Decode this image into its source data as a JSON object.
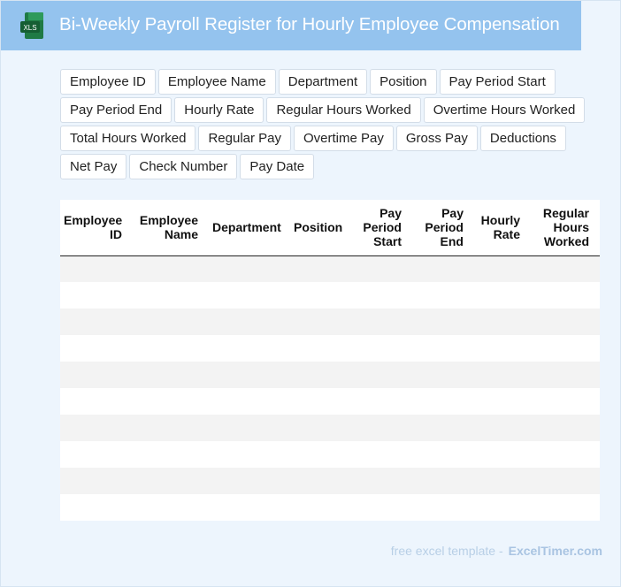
{
  "header": {
    "title": "Bi-Weekly Payroll Register for Hourly Employee Compensation",
    "icon": "xls-file-icon",
    "icon_label": "XLS",
    "background": "#94c3ee"
  },
  "fields": [
    "Employee ID",
    "Employee Name",
    "Department",
    "Position",
    "Pay Period Start",
    "Pay Period End",
    "Hourly Rate",
    "Regular Hours Worked",
    "Overtime Hours Worked",
    "Total Hours Worked",
    "Regular Pay",
    "Overtime Pay",
    "Gross Pay",
    "Deductions",
    "Net Pay",
    "Check Number",
    "Pay Date"
  ],
  "table": {
    "columns": [
      [
        "Employee",
        "ID"
      ],
      [
        "Employee",
        "Name"
      ],
      [
        "Department"
      ],
      [
        "Position"
      ],
      [
        "Pay",
        "Period",
        "Start"
      ],
      [
        "Pay",
        "Period",
        "End"
      ],
      [
        "Hourly",
        "Rate"
      ],
      [
        "Regular",
        "Hours",
        "Worked"
      ]
    ],
    "row_count": 10,
    "stripe_color": "#f3f3f3"
  },
  "footer": {
    "text": "free excel template -",
    "brand": "ExcelTimer.com"
  }
}
